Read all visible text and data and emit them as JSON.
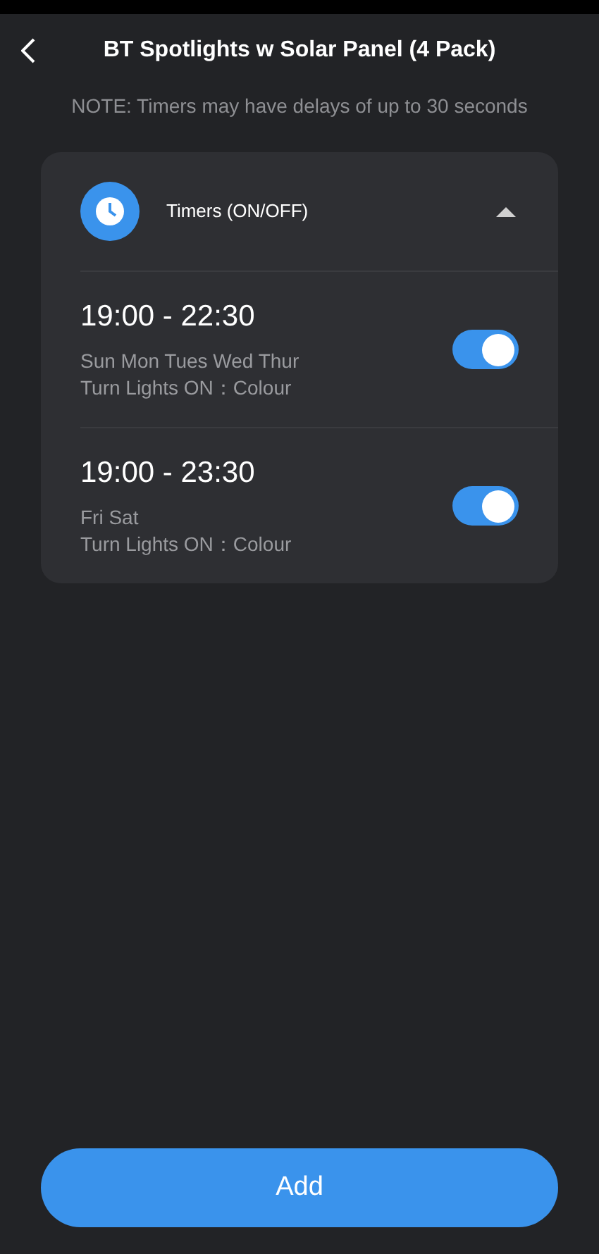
{
  "header": {
    "title": "BT Spotlights w Solar Panel (4 Pack)"
  },
  "note": "NOTE: Timers may have delays of up to 30 seconds",
  "section": {
    "title": "Timers (ON/OFF)",
    "expanded": true
  },
  "timers": [
    {
      "time": "19:00 - 22:30",
      "days": "Sun Mon Tues Wed Thur",
      "action": "Turn Lights ON：Colour",
      "on": true
    },
    {
      "time": "19:00 - 23:30",
      "days": "Fri Sat",
      "action": "Turn Lights ON：Colour",
      "on": true
    }
  ],
  "add_button": "Add"
}
